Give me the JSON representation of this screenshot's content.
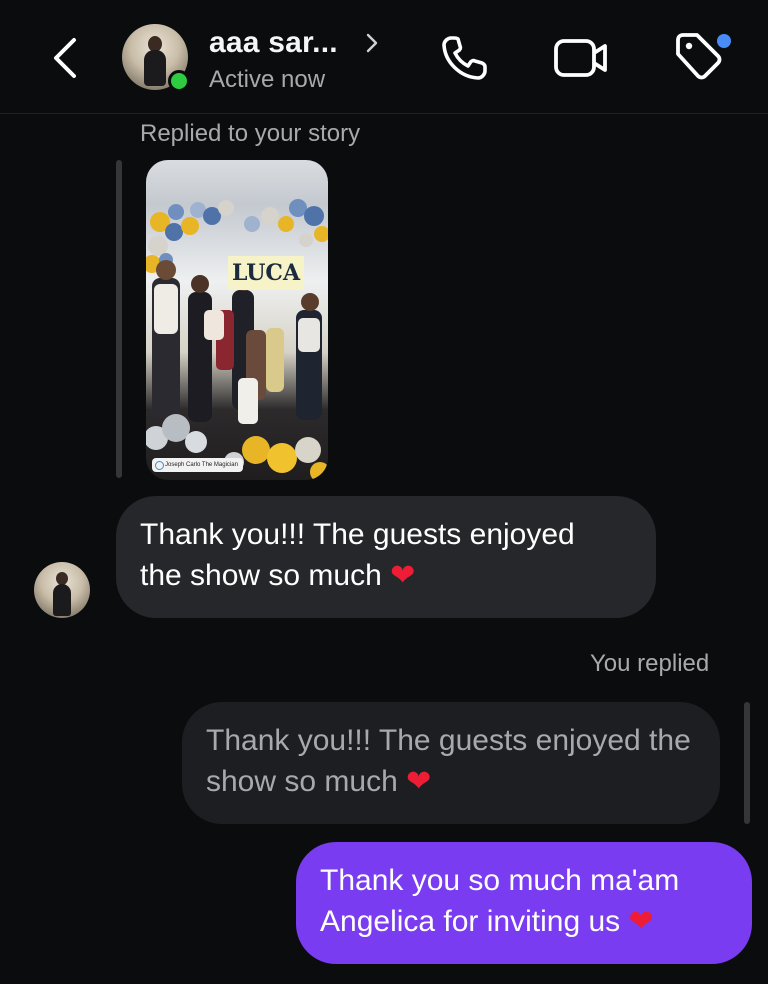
{
  "header": {
    "contact_name": "aaa sar...",
    "status": "Active now",
    "name_chevron": ">"
  },
  "story_reply": {
    "caption": "Replied to your story",
    "sign_text": "LUCA",
    "chip_text": "Joseph Carlo The Magician"
  },
  "messages": {
    "incoming": {
      "line1": "Thank you!!! The guests enjoyed",
      "line2": "the show so much"
    },
    "replied_label": "You replied",
    "quoted": {
      "line1": "Thank you!!! The guests enjoyed the",
      "line2": "show so much"
    },
    "outgoing": {
      "line1": "Thank you so much ma'am",
      "line2": "Angelica for inviting us"
    },
    "emoji": "❤"
  },
  "colors": {
    "background": "#0b0c0e",
    "incoming_bubble": "#26272b",
    "outgoing_bubble": "#7a3cf0",
    "online": "#2ecc40",
    "notification_dot": "#4a8cf7",
    "heart": "#ee1d35"
  },
  "icons": [
    "back-chevron-icon",
    "phone-icon",
    "video-camera-icon",
    "tag-icon"
  ]
}
